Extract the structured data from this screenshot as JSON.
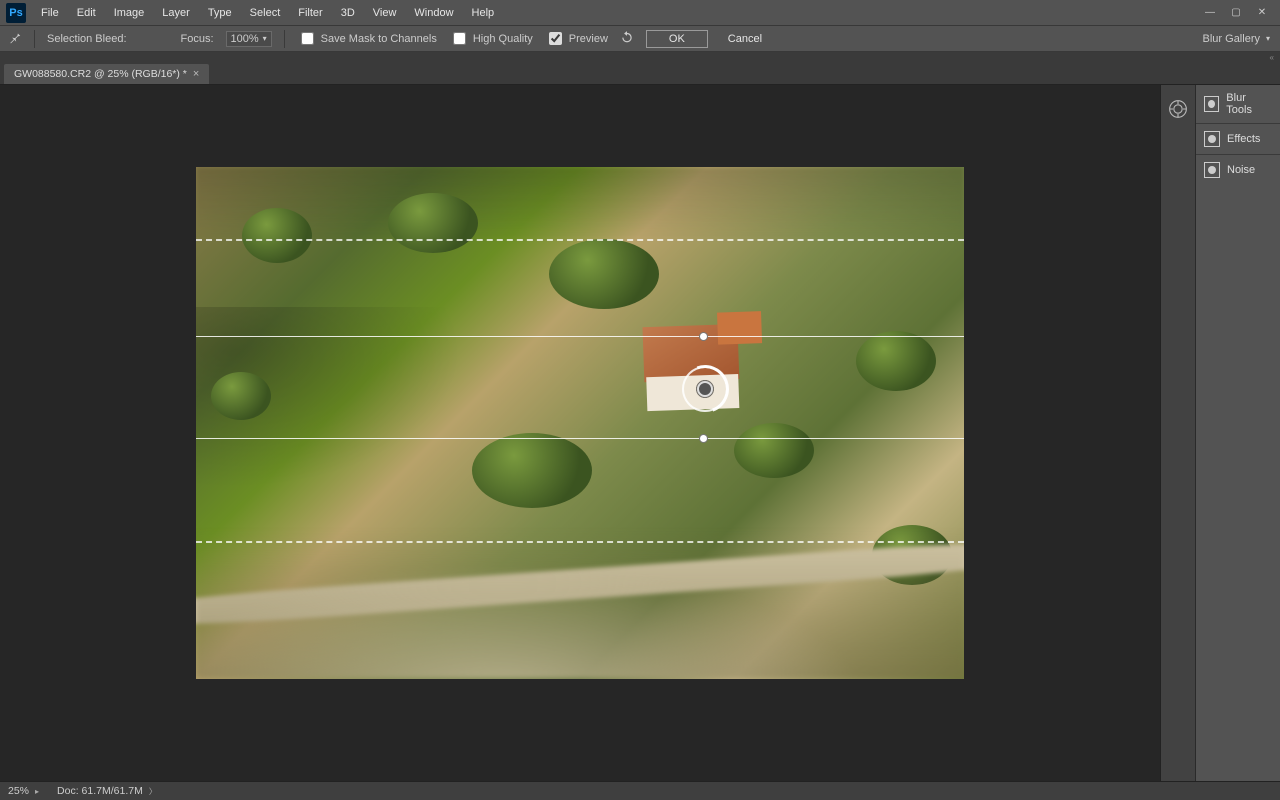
{
  "app_logo": "Ps",
  "menus": [
    "File",
    "Edit",
    "Image",
    "Layer",
    "Type",
    "Select",
    "Filter",
    "3D",
    "View",
    "Window",
    "Help"
  ],
  "window_controls": {
    "min": "—",
    "max": "▢",
    "close": "✕"
  },
  "options": {
    "selection_bleed_label": "Selection Bleed:",
    "focus_label": "Focus:",
    "focus_value": "100%",
    "save_mask_label": "Save Mask to Channels",
    "high_quality_label": "High Quality",
    "preview_label": "Preview",
    "ok_label": "OK",
    "cancel_label": "Cancel"
  },
  "workspace_label": "Blur Gallery",
  "expand_icon": "«",
  "doc_tab": {
    "title": "GW088580.CR2 @ 25% (RGB/16*) *",
    "close": "×"
  },
  "panels": {
    "0": {
      "label": "Blur Tools"
    },
    "1": {
      "label": "Effects"
    },
    "2": {
      "label": "Noise"
    }
  },
  "status": {
    "zoom": "25%",
    "doc": "Doc: 61.7M/61.7M",
    "chevron": "〉"
  }
}
